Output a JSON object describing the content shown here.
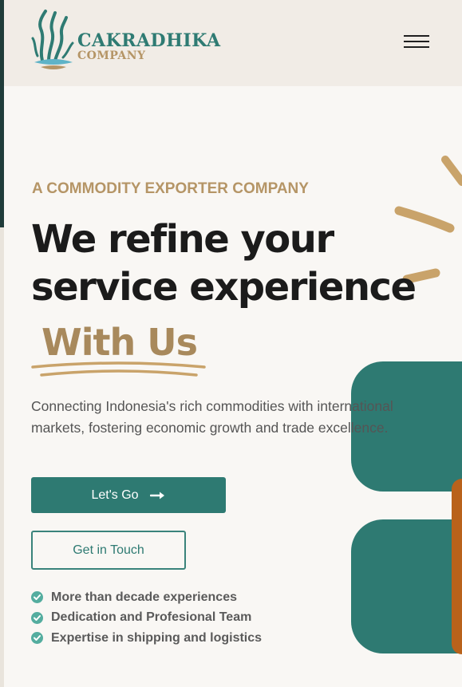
{
  "brand": {
    "name": "CAKRADHIKA",
    "subtitle": "COMPANY",
    "logo_icon": "seaweed-leaf-logo-icon"
  },
  "header": {
    "menu_icon": "hamburger-menu-icon"
  },
  "hero": {
    "eyebrow": "A COMMODITY EXPORTER COMPANY",
    "headline_line1": "We refine your",
    "headline_line2": "service experience",
    "highlight": "With Us",
    "description": "Connecting Indonesia's rich commodities with international markets, fostering economic growth and trade excellence."
  },
  "buttons": {
    "primary_label": "Let's Go",
    "primary_icon": "arrow-right-icon",
    "secondary_label": "Get in Touch"
  },
  "features": [
    {
      "label": "More than decade experiences",
      "icon": "check-circle-icon"
    },
    {
      "label": "Dedication and Profesional Team",
      "icon": "check-circle-icon"
    },
    {
      "label": "Expertise in shipping and logistics",
      "icon": "check-circle-icon"
    }
  ],
  "colors": {
    "brand_teal": "#2e7a72",
    "brand_gold": "#b59566",
    "heading": "#1b1b1b",
    "background": "#f9f7f4"
  }
}
